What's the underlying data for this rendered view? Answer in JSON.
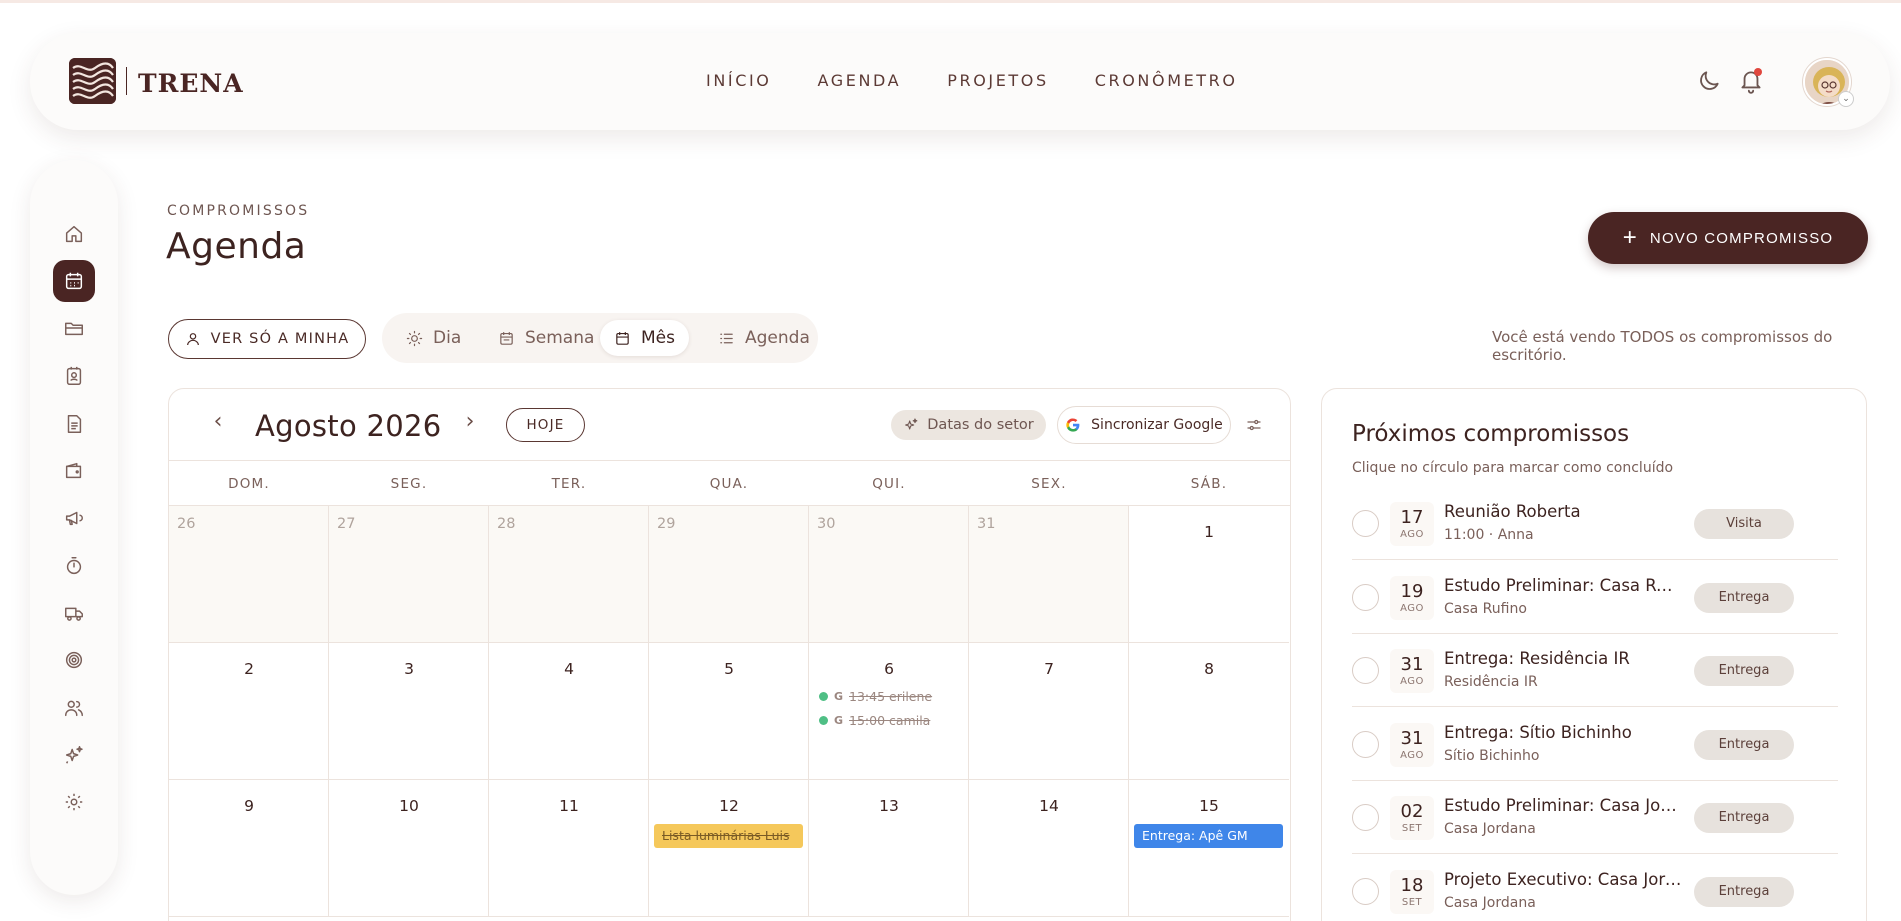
{
  "brand": {
    "name": "TRENA"
  },
  "nav": {
    "items": [
      "INÍCIO",
      "AGENDA",
      "PROJETOS",
      "CRONÔMETRO"
    ]
  },
  "header_icons": [
    "moon-icon",
    "bell-icon",
    "avatar"
  ],
  "sidebar": {
    "items": [
      {
        "icon": "home-icon",
        "active": false
      },
      {
        "icon": "calendar-icon",
        "active": true
      },
      {
        "icon": "folder-icon",
        "active": false
      },
      {
        "icon": "contact-icon",
        "active": false
      },
      {
        "icon": "document-icon",
        "active": false
      },
      {
        "icon": "wallet-icon",
        "active": false
      },
      {
        "icon": "megaphone-icon",
        "active": false
      },
      {
        "icon": "stopwatch-icon",
        "active": false
      },
      {
        "icon": "truck-icon",
        "active": false
      },
      {
        "icon": "target-icon",
        "active": false
      },
      {
        "icon": "users-icon",
        "active": false
      },
      {
        "icon": "sparkles-icon",
        "active": false
      },
      {
        "icon": "gear-icon",
        "active": false
      }
    ]
  },
  "page": {
    "kicker": "COMPROMISSOS",
    "title": "Agenda",
    "new_button": "NOVO COMPROMISSO",
    "ver_button": "VER SÓ A MINHA",
    "view_tabs": [
      {
        "label": "Dia",
        "icon": "sun-icon",
        "active": false
      },
      {
        "label": "Semana",
        "icon": "calendar-week-icon",
        "active": false
      },
      {
        "label": "Mês",
        "icon": "calendar-month-icon",
        "active": true
      },
      {
        "label": "Agenda",
        "icon": "list-icon",
        "active": false
      }
    ],
    "view_note": "Você está vendo TODOS os compromissos do escritório."
  },
  "calendar": {
    "month_label": "Agosto 2026",
    "today_button": "HOJE",
    "setor_button": "Datas do setor",
    "google_button": "Sincronizar Google",
    "weekdays": [
      "DOM.",
      "SEG.",
      "TER.",
      "QUA.",
      "QUI.",
      "SEX.",
      "SÁB."
    ],
    "weeks": [
      [
        {
          "day": "26",
          "out": true
        },
        {
          "day": "27",
          "out": true
        },
        {
          "day": "28",
          "out": true
        },
        {
          "day": "29",
          "out": true
        },
        {
          "day": "30",
          "out": true
        },
        {
          "day": "31",
          "out": true
        },
        {
          "day": "1",
          "out": false
        }
      ],
      [
        {
          "day": "2",
          "out": false
        },
        {
          "day": "3",
          "out": false
        },
        {
          "day": "4",
          "out": false
        },
        {
          "day": "5",
          "out": false
        },
        {
          "day": "6",
          "out": false,
          "google_events": [
            {
              "source": "G",
              "text": "13:45 erilene"
            },
            {
              "source": "G",
              "text": "15:00 camila"
            }
          ]
        },
        {
          "day": "7",
          "out": false
        },
        {
          "day": "8",
          "out": false
        }
      ],
      [
        {
          "day": "9",
          "out": false
        },
        {
          "day": "10",
          "out": false
        },
        {
          "day": "11",
          "out": false
        },
        {
          "day": "12",
          "out": false,
          "bar_events": [
            {
              "text": "Lista luminárias Luis",
              "color": "#f5c85b",
              "done": true
            }
          ]
        },
        {
          "day": "13",
          "out": false
        },
        {
          "day": "14",
          "out": false
        },
        {
          "day": "15",
          "out": false,
          "bar_events": [
            {
              "text": "Entrega: Apê GM",
              "color": "#3f86e9",
              "done": false
            }
          ]
        }
      ]
    ]
  },
  "upcoming": {
    "title": "Próximos compromissos",
    "subtitle": "Clique no círculo para marcar como concluído",
    "items": [
      {
        "day": "17",
        "month": "AGO",
        "title": "Reunião Roberta",
        "sub": "11:00 · Anna",
        "badge": "Visita"
      },
      {
        "day": "19",
        "month": "AGO",
        "title": "Estudo Preliminar: Casa Rufino",
        "sub": "Casa Rufino",
        "badge": "Entrega"
      },
      {
        "day": "31",
        "month": "AGO",
        "title": "Entrega: Residência IR",
        "sub": "Residência IR",
        "badge": "Entrega"
      },
      {
        "day": "31",
        "month": "AGO",
        "title": "Entrega: Sítio Bichinho",
        "sub": "Sítio Bichinho",
        "badge": "Entrega"
      },
      {
        "day": "02",
        "month": "SET",
        "title": "Estudo Preliminar: Casa Jordana",
        "sub": "Casa Jordana",
        "badge": "Entrega"
      },
      {
        "day": "18",
        "month": "SET",
        "title": "Projeto Executivo: Casa Jordana",
        "sub": "Casa Jordana",
        "badge": "Entrega"
      }
    ]
  },
  "colors": {
    "brand_dark": "#4a2523",
    "text_main": "#3d2320",
    "event_green": "#4fbf85",
    "event_yellow": "#f5c85b",
    "event_blue": "#3f86e9",
    "notification_red": "#e0473e"
  }
}
